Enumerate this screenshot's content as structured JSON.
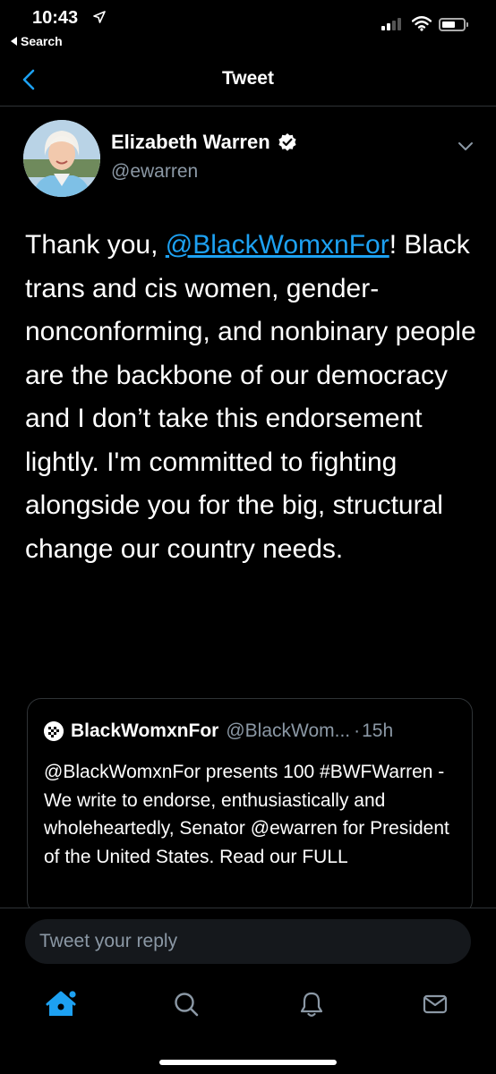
{
  "status_bar": {
    "time": "10:43",
    "back_app_label": "Search"
  },
  "nav": {
    "title": "Tweet"
  },
  "tweet": {
    "author_name": "Elizabeth Warren",
    "author_handle": "@ewarren",
    "verified": true,
    "text_before_mention": "Thank you, ",
    "mention": "@BlackWomxnFor",
    "text_after_mention": "! Black trans and cis women, gender-nonconforming, and nonbinary people are the backbone of our democracy and I don’t take this endorsement lightly. I'm committed to fighting alongside you for the big, structural change our country needs."
  },
  "quoted_tweet": {
    "author_name": "BlackWomxnFor",
    "author_handle": "@BlackWom...",
    "separator": "·",
    "time": "15h",
    "text": "@BlackWomxnFor presents 100 #BWFWarren - We write to endorse, enthusiastically and wholeheartedly, Senator @ewarren for President of the United States. Read our FULL"
  },
  "reply": {
    "placeholder": "Tweet your reply"
  },
  "tabs": [
    {
      "icon": "home-icon",
      "active": true
    },
    {
      "icon": "search-icon",
      "active": false
    },
    {
      "icon": "notifications-bell-icon",
      "active": false
    },
    {
      "icon": "messages-envelope-icon",
      "active": false
    }
  ],
  "colors": {
    "background": "#000000",
    "link": "#1da1f2",
    "secondary_text": "#8b98a5",
    "divider": "#2f3336"
  }
}
